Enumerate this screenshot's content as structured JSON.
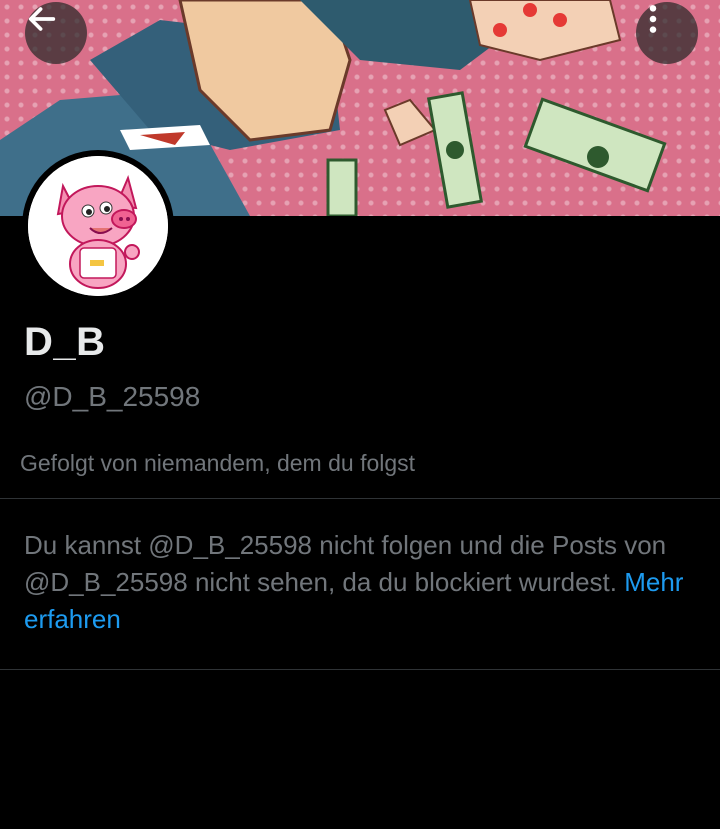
{
  "header": {
    "back_icon": "arrow-left-icon",
    "more_icon": "more-vertical-icon"
  },
  "profile": {
    "display_name": "D_B",
    "handle": "@D_B_25598",
    "followed_by": "Gefolgt von niemandem, dem du folgst"
  },
  "blocked_notice": {
    "text": "Du kannst @D_B_25598 nicht folgen und die Posts von @D_B_25598 nicht sehen, da du blockiert wurdest.",
    "link_label": "Mehr erfahren"
  },
  "colors": {
    "background": "#000000",
    "primary_text": "#e7e9ea",
    "secondary_text": "#71767b",
    "link": "#1d9bf0",
    "divider": "#2f3336"
  }
}
